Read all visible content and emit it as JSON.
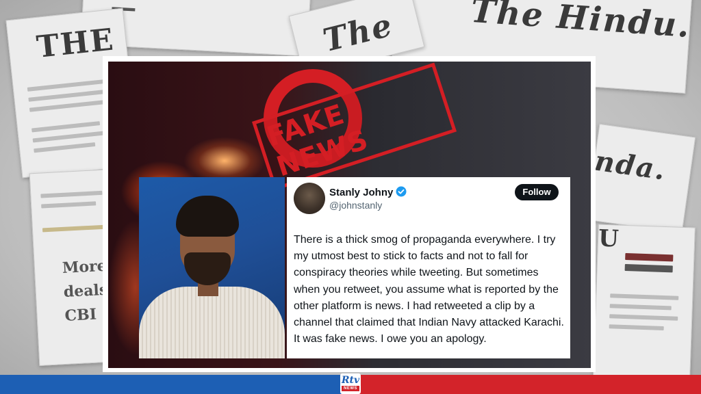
{
  "background": {
    "mastheads": [
      "The Hindu.",
      "THE",
      "The",
      "nda.",
      "U"
    ],
    "headlines": [
      "More",
      "deals",
      "CBI"
    ]
  },
  "stamp": {
    "text": "FAKE NEWS",
    "color": "#d41e24"
  },
  "tweet": {
    "name": "Stanly Johny",
    "handle": "@johnstanly",
    "verified": true,
    "follow_label": "Follow",
    "text": "There is a thick smog of propaganda everywhere. I try my utmost best to stick to facts and not to fall for conspiracy theories while tweeting. But sometimes when you retweet, you assume what is reported by the other platform is news. I had retweeted a clip by a channel that claimed that Indian Navy attacked Karachi. It was fake news. I owe you an apology."
  },
  "footer": {
    "logo_mark": "Rtv",
    "logo_sub": "NEWS",
    "colors": {
      "left": "#1d5fb4",
      "right": "#d3232a"
    }
  }
}
